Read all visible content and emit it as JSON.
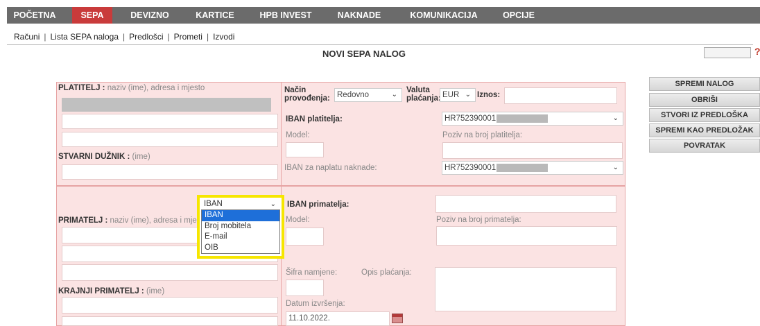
{
  "nav": {
    "items": [
      {
        "label": "POČETNA"
      },
      {
        "label": "SEPA"
      },
      {
        "label": "DEVIZNO"
      },
      {
        "label": "KARTICE"
      },
      {
        "label": "HPB INVEST"
      },
      {
        "label": "NAKNADE"
      },
      {
        "label": "KOMUNIKACIJA"
      },
      {
        "label": "OPCIJE"
      }
    ],
    "active": "SEPA"
  },
  "subnav": {
    "items": [
      {
        "label": "Računi"
      },
      {
        "label": "Lista SEPA naloga"
      },
      {
        "label": "Predlošci"
      },
      {
        "label": "Prometi"
      },
      {
        "label": "Izvodi"
      }
    ],
    "separator": "|"
  },
  "page": {
    "title": "NOVI SEPA NALOG",
    "help_mark": "?"
  },
  "payer": {
    "label": "PLATITELJ :",
    "hint": "naziv (ime), adresa i mjesto",
    "actual_debtor_label": "STVARNI DUŽNIK :",
    "actual_debtor_hint": "(ime)"
  },
  "execution": {
    "method_label_1": "Način",
    "method_label_2": "provođenja:",
    "method_value": "Redovno",
    "currency_label_1": "Valuta",
    "currency_label_2": "plaćanja:",
    "currency_value": "EUR",
    "amount_label": "Iznos:"
  },
  "payer_iban": {
    "label": "IBAN platitelja:",
    "value": "HR752390001",
    "model_label": "Model:",
    "reference_label": "Poziv na broj platitelja:",
    "fee_iban_label": "IBAN za naplatu naknade:",
    "fee_iban_value": "HR752390001"
  },
  "recipient": {
    "label": "PRIMATELJ :",
    "hint": "naziv (ime), adresa i mjesto",
    "final_label": "KRAJNJI PRIMATELJ :",
    "final_hint": "(ime)",
    "id_type_selected": "IBAN",
    "id_type_options": [
      "IBAN",
      "Broj mobitela",
      "E-mail",
      "OIB"
    ],
    "iban_label": "IBAN primatelja:",
    "model_label": "Model:",
    "reference_label": "Poziv na broj primatelja:",
    "purpose_code_label": "Šifra namjene:",
    "description_label": "Opis plaćanja:",
    "execution_date_label": "Datum izvršenja:",
    "execution_date_value": "11.10.2022."
  },
  "actions": {
    "save": "SPREMI NALOG",
    "delete": "OBRIŠI",
    "from_template": "STVORI IZ PREDLOŠKA",
    "save_as_template": "SPREMI KAO PREDLOŽAK",
    "back": "POVRATAK"
  },
  "colors": {
    "nav_bg": "#6b6b6b",
    "nav_active": "#c93b3b",
    "panel_bg": "#fbe3e3",
    "highlight": "#f6e600"
  },
  "icons": {
    "dropdown": "chevron-down-icon",
    "calendar": "calendar-icon"
  }
}
